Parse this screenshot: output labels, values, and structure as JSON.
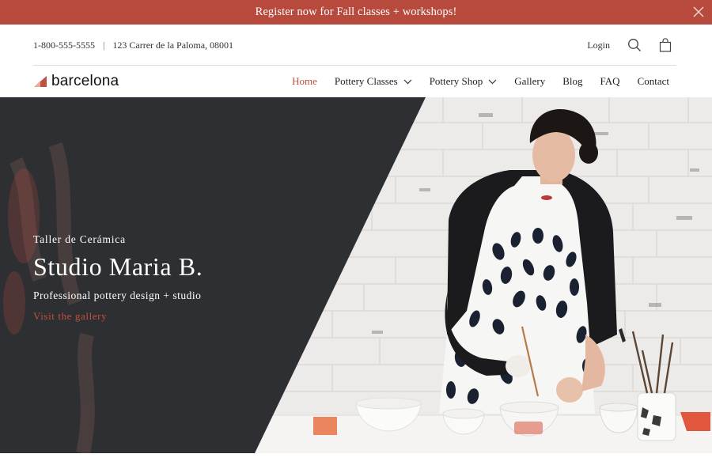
{
  "announcement": {
    "text": "Register now for Fall classes + workshops!"
  },
  "utility": {
    "phone": "1-800-555-5555",
    "separator": "|",
    "address": "123 Carrer de la Paloma, 08001",
    "login": "Login"
  },
  "brand": {
    "name": "barcelona"
  },
  "nav": {
    "items": [
      {
        "label": "Home",
        "active": true
      },
      {
        "label": "Pottery Classes",
        "dropdown": true
      },
      {
        "label": "Pottery Shop",
        "dropdown": true
      },
      {
        "label": "Gallery"
      },
      {
        "label": "Blog"
      },
      {
        "label": "FAQ"
      },
      {
        "label": "Contact"
      }
    ]
  },
  "hero": {
    "kicker": "Taller de Cerámica",
    "title": "Studio Maria B.",
    "subtitle": "Professional pottery design + studio",
    "link": "Visit the gallery"
  },
  "colors": {
    "accent": "#b84a3d",
    "link": "#c0503f",
    "overlay": "#2e2f33"
  },
  "icons": [
    "close-icon",
    "search-icon",
    "shopping-bag-icon",
    "brand-logo-icon",
    "chevron-down-icon"
  ]
}
